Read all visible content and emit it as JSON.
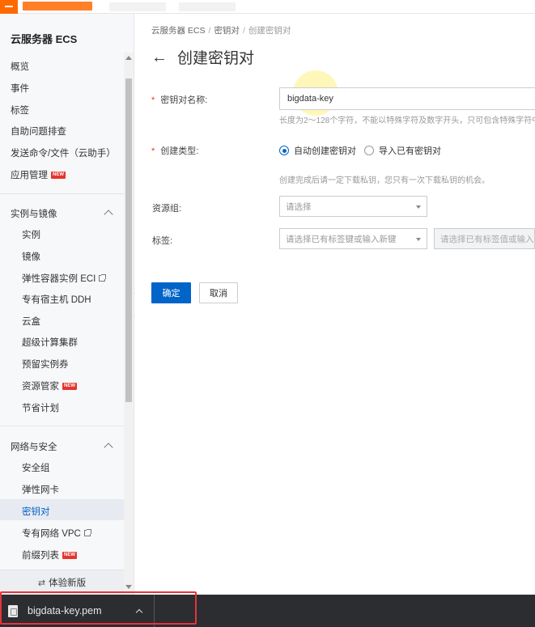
{
  "sidebar": {
    "title": "云服务器 ECS",
    "top_items": [
      "概览",
      "事件",
      "标签",
      "自助问题排查",
      "发送命令/文件（云助手）",
      "应用管理"
    ],
    "group1": {
      "label": "实例与镜像",
      "items": [
        "实例",
        "镜像",
        "弹性容器实例 ECI",
        "专有宿主机 DDH",
        "云盒",
        "超级计算集群",
        "预留实例券",
        "资源管家",
        "节省计划"
      ]
    },
    "group2": {
      "label": "网络与安全",
      "items": [
        "安全组",
        "弹性网卡",
        "密钥对",
        "专有网络 VPC",
        "前缀列表"
      ]
    },
    "new_badge": "NEW",
    "footer": "体验新版"
  },
  "breadcrumb": {
    "root": "云服务器 ECS",
    "parent": "密钥对",
    "current": "创建密钥对",
    "separator": "/"
  },
  "page": {
    "title": "创建密钥对"
  },
  "form": {
    "name_label": "密钥对名称:",
    "name_value": "bigdata-key",
    "name_hint": "长度为2～128个字符，不能以特殊字符及数字开头，只可包含特殊字符中",
    "type_label": "创建类型:",
    "type_auto": "自动创建密钥对",
    "type_import": "导入已有密钥对",
    "type_hint": "创建完成后请一定下载私钥，您只有一次下载私钥的机会。",
    "rg_label": "资源组:",
    "rg_placeholder": "请选择",
    "tag_label": "标签:",
    "tag_key_placeholder": "请选择已有标签键或输入新键",
    "tag_value_placeholder": "请选择已有标签值或输入新",
    "required_mark": "*",
    "confirm": "确定",
    "cancel": "取消"
  },
  "download": {
    "filename": "bigdata-key.pem"
  },
  "colors": {
    "primary": "#0064c8",
    "brand": "#ff6a00",
    "badge": "#e6352e",
    "highlight_outline": "#e8333a"
  }
}
